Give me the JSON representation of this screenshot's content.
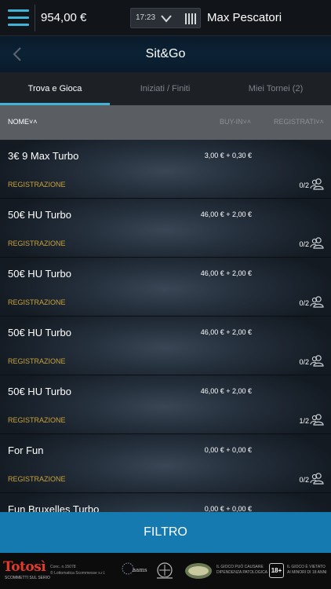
{
  "topbar": {
    "balance": "954,00 €",
    "time": "17:23",
    "username": "Max Pescatori"
  },
  "header": {
    "title": "Sit&Go"
  },
  "tabs": [
    {
      "label": "Trova e Gioca",
      "active": true
    },
    {
      "label": "Iniziati / Finiti",
      "active": false
    },
    {
      "label": "Miei Tornei (2)",
      "active": false
    }
  ],
  "columns": {
    "name": "NOME˅˄",
    "buyin": "BUY-IN˅˄",
    "registered": "REGISTRATI˅˄"
  },
  "tournaments": [
    {
      "name": "3€ 9 Max Turbo",
      "buyin": "3,00 € + 0,30 €",
      "status": "REGISTRAZIONE",
      "registered": "0/2"
    },
    {
      "name": "50€ HU Turbo",
      "buyin": "46,00 € + 2,00 €",
      "status": "REGISTRAZIONE",
      "registered": "0/2"
    },
    {
      "name": "50€ HU Turbo",
      "buyin": "46,00 € + 2,00 €",
      "status": "REGISTRAZIONE",
      "registered": "0/2"
    },
    {
      "name": "50€ HU Turbo",
      "buyin": "46,00 € + 2,00 €",
      "status": "REGISTRAZIONE",
      "registered": "0/2"
    },
    {
      "name": "50€ HU Turbo",
      "buyin": "46,00 € + 2,00 €",
      "status": "REGISTRAZIONE",
      "registered": "1/2"
    },
    {
      "name": "For Fun",
      "buyin": "0,00 € + 0,00 €",
      "status": "REGISTRAZIONE",
      "registered": "0/2"
    },
    {
      "name": "Fun Bruxelles Turbo",
      "buyin": "0,00 € + 0,00 €",
      "status": "",
      "registered": ""
    }
  ],
  "filter_button": "FILTRO",
  "footer": {
    "logo": "Totosì",
    "logo_sub": "SCOMMETTI SUL SERIO",
    "conc_line1": "Conc. n.15078",
    "conc_line2": "© Lottomatica Scommesse s.r.l.",
    "aams": "aams",
    "warning_line1": "IL GIOCO PUÒ CAUSARE",
    "warning_line2": "DIPENDENZA PATOLOGICA",
    "age_badge": "18+",
    "minors_line1": "IL GIOCO È VIETATO",
    "minors_line2": "AI MINORI DI 18 ANNI"
  },
  "colors": {
    "accent": "#3fb4d6",
    "status": "#c9a23a",
    "filter": "#147aaf"
  }
}
